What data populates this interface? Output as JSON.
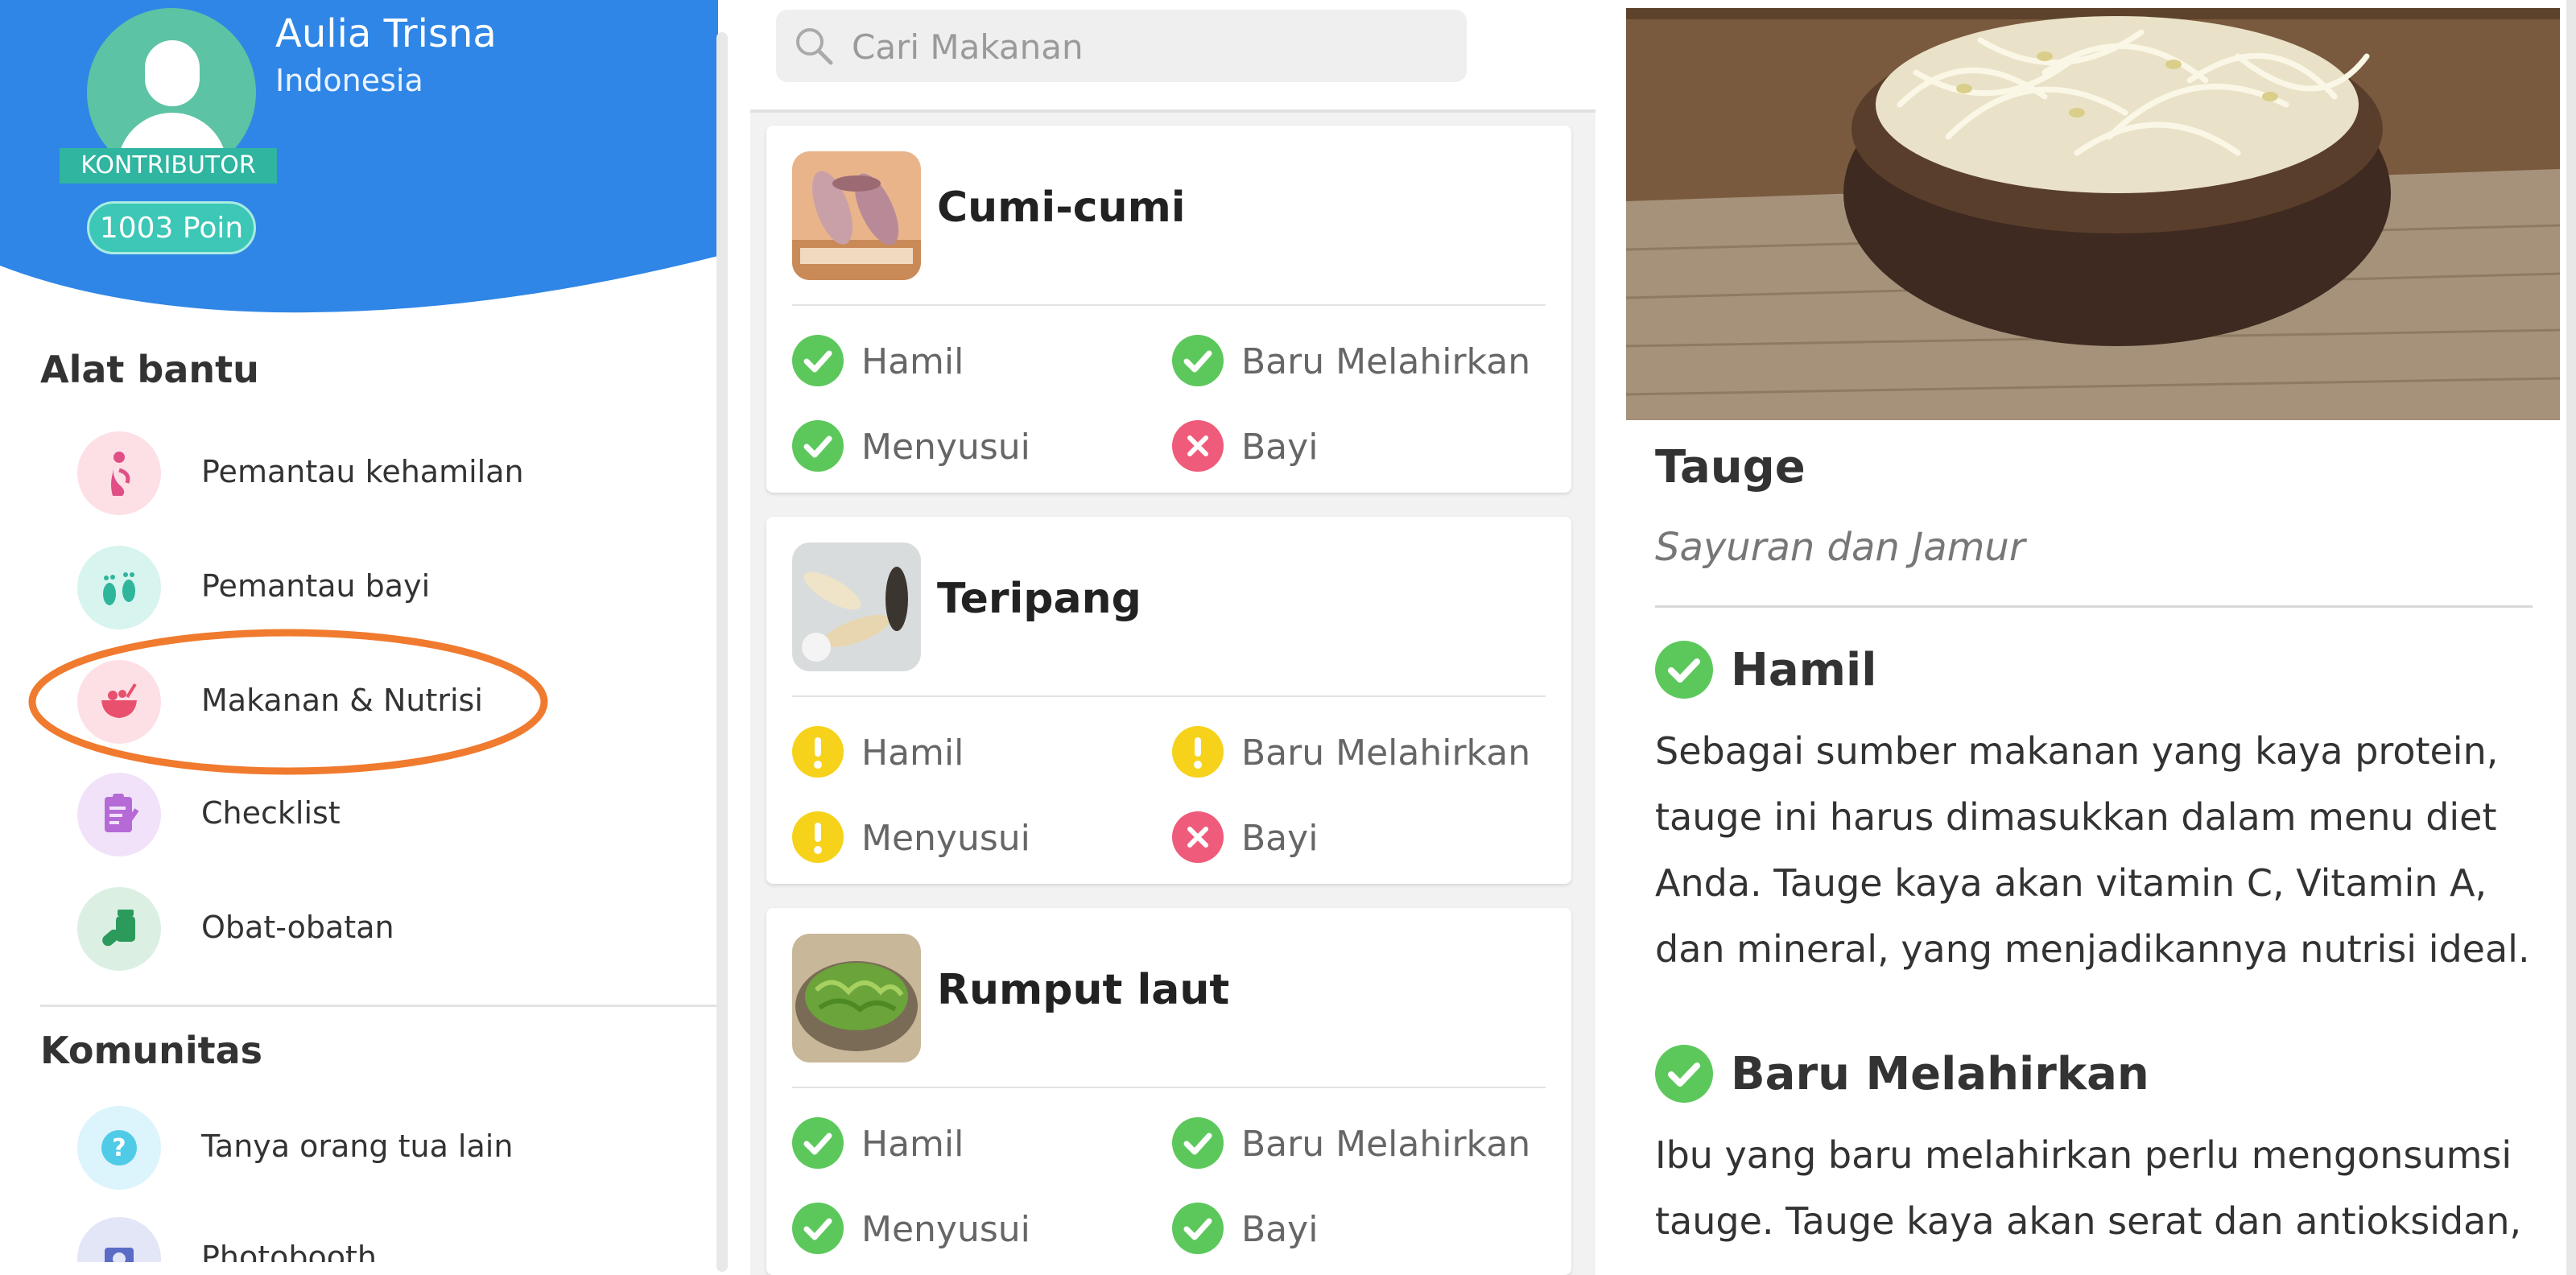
{
  "drawer": {
    "user": {
      "name": "Aulia Trisna",
      "country": "Indonesia",
      "badge": "KONTRIBUTOR",
      "points": "1003 Poin"
    },
    "colors": {
      "header": "#2f86e6",
      "highlight_ring": "#f07a2e"
    },
    "tools_title": "Alat bantu",
    "tools": [
      {
        "label": "Pemantau kehamilan",
        "icon": "pregnancy-icon",
        "bg": "#fde0e6"
      },
      {
        "label": "Pemantau bayi",
        "icon": "baby-feet-icon",
        "bg": "#d7f4ef"
      },
      {
        "label": "Makanan & Nutrisi",
        "icon": "food-bowl-icon",
        "bg": "#fde0e6"
      },
      {
        "label": "Checklist",
        "icon": "checklist-icon",
        "bg": "#f1e2fa"
      },
      {
        "label": "Obat-obatan",
        "icon": "medicine-icon",
        "bg": "#dbf0e2"
      }
    ],
    "community_title": "Komunitas",
    "community": [
      {
        "label": "Tanya orang tua lain",
        "icon": "question-icon",
        "bg": "#dcf4fb"
      },
      {
        "label": "Photobooth",
        "icon": "photobooth-icon",
        "bg": "#e3e6f7"
      }
    ]
  },
  "list": {
    "search_placeholder": "Cari Makanan",
    "foods": [
      {
        "name": "Cumi-cumi",
        "thumb": "squid-thumbnail",
        "statuses": [
          {
            "label": "Hamil",
            "state": "ok"
          },
          {
            "label": "Baru Melahirkan",
            "state": "ok"
          },
          {
            "label": "Menyusui",
            "state": "ok"
          },
          {
            "label": "Bayi",
            "state": "no"
          }
        ]
      },
      {
        "name": "Teripang",
        "thumb": "sea-cucumber-thumbnail",
        "statuses": [
          {
            "label": "Hamil",
            "state": "warn"
          },
          {
            "label": "Baru Melahirkan",
            "state": "warn"
          },
          {
            "label": "Menyusui",
            "state": "warn"
          },
          {
            "label": "Bayi",
            "state": "no"
          }
        ]
      },
      {
        "name": "Rumput laut",
        "thumb": "seaweed-thumbnail",
        "statuses": [
          {
            "label": "Hamil",
            "state": "ok"
          },
          {
            "label": "Baru Melahirkan",
            "state": "ok"
          },
          {
            "label": "Menyusui",
            "state": "ok"
          },
          {
            "label": "Bayi",
            "state": "ok"
          }
        ]
      }
    ]
  },
  "detail": {
    "title": "Tauge",
    "category": "Sayuran dan Jamur",
    "sections": [
      {
        "heading": "Hamil",
        "text": "Sebagai sumber makanan yang kaya protein, tauge ini harus dimasukkan dalam menu diet Anda. Tauge kaya akan vitamin C, Vitamin A, dan mineral, yang menjadikannya nutrisi ideal."
      },
      {
        "heading": "Baru Melahirkan",
        "text": "Ibu yang baru melahirkan perlu mengonsumsi tauge. Tauge kaya akan serat dan antioksidan,"
      }
    ]
  }
}
